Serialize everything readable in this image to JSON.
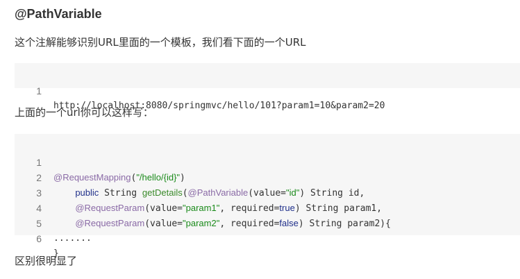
{
  "heading": "@PathVariable",
  "intro": "这个注解能够识别URL里面的一个模板，我们看下面的一个URL",
  "code_block_1": {
    "lines": [
      {
        "number": "1",
        "text": "http://localhost:8080/springmvc/hello/101?param1=10&param2=20"
      }
    ]
  },
  "middle_text": "上面的一个url你可以这样写：",
  "code_block_2": {
    "line_numbers": [
      "1",
      "2",
      "3",
      "4",
      "5",
      "6"
    ],
    "line1": {
      "ann": "@RequestMapping",
      "p1": "(",
      "str": "\"/hello/{id}\"",
      "p2": ")"
    },
    "line2": {
      "indent": "    ",
      "kw": "public",
      "t1": " String ",
      "fn": "getDetails",
      "p1": "(",
      "ann": "@PathVariable",
      "p2": "(value=",
      "str": "\"id\"",
      "p3": ") String id,"
    },
    "line3": {
      "indent": "    ",
      "ann": "@RequestParam",
      "p1": "(value=",
      "str": "\"param1\"",
      "p2": ", required=",
      "kw": "true",
      "p3": ") String param1,"
    },
    "line4": {
      "indent": "    ",
      "ann": "@RequestParam",
      "p1": "(value=",
      "str": "\"param2\"",
      "p2": ", required=",
      "kw": "false",
      "p3": ") String param2){"
    },
    "line5": {
      "text": "......."
    },
    "line6": {
      "text": "}"
    }
  },
  "footer_text": "区别很明显了"
}
